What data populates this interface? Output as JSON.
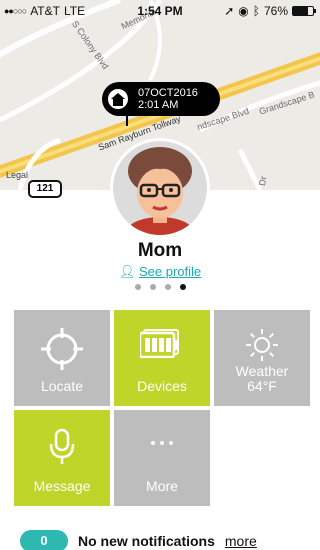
{
  "status": {
    "signal_dots": "●●○○○",
    "carrier": "AT&T",
    "network": "LTE",
    "time": "1:54 PM",
    "battery": "76%",
    "battery_level": 0.76
  },
  "map": {
    "roads": [
      "Memorial",
      "S Colony Blvd",
      "Sam Rayburn Tollway",
      "ndscape Blvd",
      "Grandscape B",
      "Dr"
    ],
    "legal": "Legal",
    "highway": "121",
    "bubble": {
      "date": "07OCT2016",
      "time": "2:01 AM"
    }
  },
  "profile": {
    "name": "Mom",
    "link": "See profile",
    "page_count": 4,
    "active_page": 3
  },
  "tiles": [
    {
      "label": "Locate",
      "icon": "crosshair-icon",
      "color": "gray"
    },
    {
      "label": "Devices",
      "icon": "battery-devices-icon",
      "color": "green"
    },
    {
      "label": "Weather",
      "sub": "64°F",
      "icon": "sun-icon",
      "color": "gray"
    },
    {
      "label": "Message",
      "icon": "microphone-icon",
      "color": "green"
    },
    {
      "label": "More",
      "icon": "ellipsis-icon",
      "color": "gray"
    }
  ],
  "notifications": {
    "count": "0",
    "text": "No new notifications",
    "more": "more"
  },
  "colors": {
    "accent": "#1aa9b5",
    "green": "#bfd52a",
    "gray": "#bdbdbd",
    "badge": "#2db8b0"
  }
}
